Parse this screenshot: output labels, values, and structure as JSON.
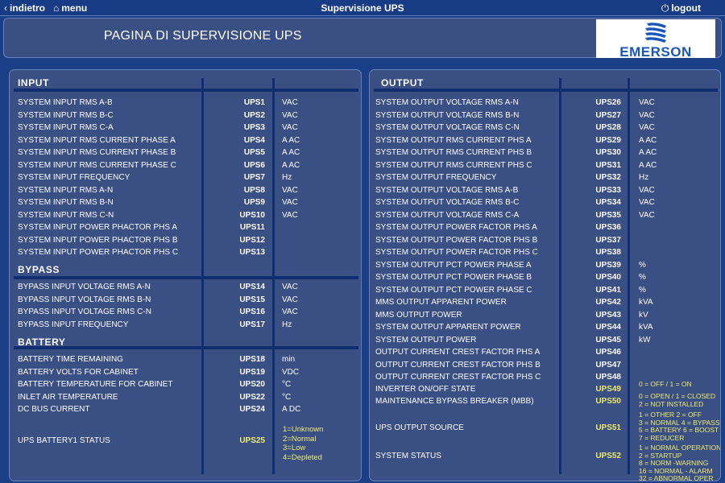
{
  "topbar": {
    "back_label": "indietro",
    "menu_label": "menu",
    "title": "Supervisione UPS",
    "logout_label": "logout"
  },
  "header": {
    "page_title": "PAGINA DI SUPERVISIONE UPS",
    "logo_text": "EMERSON"
  },
  "colors": {
    "background": "#1a3f86",
    "panel": "#3a4f84",
    "divider": "#102d70",
    "highlight": "#ecec6e",
    "logo_blue": "#1a56b8"
  },
  "icons": {
    "back": "chevron-left-icon",
    "menu": "home-icon",
    "logout": "power-icon"
  },
  "left": {
    "input_title": "INPUT",
    "input_rows": [
      {
        "label": "SYSTEM INPUT RMS A-B",
        "code": "UPS1",
        "unit": "VAC"
      },
      {
        "label": "SYSTEM INPUT RMS B-C",
        "code": "UPS2",
        "unit": "VAC"
      },
      {
        "label": "SYSTEM INPUT RMS C-A",
        "code": "UPS3",
        "unit": "VAC"
      },
      {
        "label": "SYSTEM INPUT RMS CURRENT PHASE A",
        "code": "UPS4",
        "unit": "A AC"
      },
      {
        "label": "SYSTEM INPUT RMS CURRENT PHASE B",
        "code": "UPS5",
        "unit": "A AC"
      },
      {
        "label": "SYSTEM INPUT RMS CURRENT PHASE C",
        "code": "UPS6",
        "unit": "A AC"
      },
      {
        "label": "SYSTEM INPUT FREQUENCY",
        "code": "UPS7",
        "unit": "Hz"
      },
      {
        "label": "SYSTEM INPUT RMS A-N",
        "code": "UPS8",
        "unit": "VAC"
      },
      {
        "label": "SYSTEM INPUT RMS B-N",
        "code": "UPS9",
        "unit": "VAC"
      },
      {
        "label": "SYSTEM INPUT RMS C-N",
        "code": "UPS10",
        "unit": "VAC"
      },
      {
        "label": "SYSTEM INPUT POWER PHACTOR PHS A",
        "code": "UPS11",
        "unit": ""
      },
      {
        "label": "SYSTEM INPUT POWER PHACTOR PHS B",
        "code": "UPS12",
        "unit": ""
      },
      {
        "label": "SYSTEM INPUT POWER PHACTOR PHS C",
        "code": "UPS13",
        "unit": ""
      }
    ],
    "bypass_title": "BYPASS",
    "bypass_rows": [
      {
        "label": "BYPASS INPUT VOLTAGE RMS A-N",
        "code": "UPS14",
        "unit": "VAC"
      },
      {
        "label": "BYPASS INPUT VOLTAGE RMS B-N",
        "code": "UPS15",
        "unit": "VAC"
      },
      {
        "label": "BYPASS INPUT VOLTAGE RMS C-N",
        "code": "UPS16",
        "unit": "VAC"
      },
      {
        "label": "BYPASS INPUT FREQUENCY",
        "code": "UPS17",
        "unit": "Hz"
      }
    ],
    "battery_title": "BATTERY",
    "battery_rows": [
      {
        "label": "BATTERY TIME REMAINING",
        "code": "UPS18",
        "unit": "min"
      },
      {
        "label": "BATTERY VOLTS FOR CABINET",
        "code": "UPS19",
        "unit": "VDC"
      },
      {
        "label": "BATTERY TEMPERATURE FOR CABINET",
        "code": "UPS20",
        "unit": "°C"
      },
      {
        "label": "INLET AIR TEMPERATURE",
        "code": "UPS22",
        "unit": "°C"
      },
      {
        "label": "DC BUS CURRENT",
        "code": "UPS24",
        "unit": "A DC"
      }
    ],
    "battery_status": {
      "label": "UPS BATTERY1 STATUS",
      "code": "UPS25",
      "notes": [
        "1=Unknown",
        "2=Normal",
        "3=Low",
        "4=Depleted"
      ]
    }
  },
  "right": {
    "output_title": "OUTPUT",
    "output_rows": [
      {
        "label": "SYSTEM OUTPUT VOLTAGE RMS A-N",
        "code": "UPS26",
        "unit": "VAC"
      },
      {
        "label": "SYSTEM OUTPUT VOLTAGE RMS B-N",
        "code": "UPS27",
        "unit": "VAC"
      },
      {
        "label": "SYSTEM OUTPUT VOLTAGE RMS C-N",
        "code": "UPS28",
        "unit": "VAC"
      },
      {
        "label": "SYSTEM OUTPUT RMS CURRENT PHS A",
        "code": "UPS29",
        "unit": "A AC"
      },
      {
        "label": "SYSTEM OUTPUT RMS CURRENT PHS B",
        "code": "UPS30",
        "unit": "A AC"
      },
      {
        "label": "SYSTEM OUTPUT RMS CURRENT PHS C",
        "code": "UPS31",
        "unit": "A AC"
      },
      {
        "label": "SYSTEM OUTPUT FREQUENCY",
        "code": "UPS32",
        "unit": "Hz"
      },
      {
        "label": "SYSTEM OUTPUT VOLTAGE RMS A-B",
        "code": "UPS33",
        "unit": "VAC"
      },
      {
        "label": "SYSTEM OUTPUT VOLTAGE RMS B-C",
        "code": "UPS34",
        "unit": "VAC"
      },
      {
        "label": "SYSTEM OUTPUT VOLTAGE RMS C-A",
        "code": "UPS35",
        "unit": "VAC"
      },
      {
        "label": "SYSTEM OUTPUT POWER FACTOR PHS A",
        "code": "UPS36",
        "unit": ""
      },
      {
        "label": "SYSTEM OUTPUT POWER FACTOR PHS B",
        "code": "UPS37",
        "unit": ""
      },
      {
        "label": "SYSTEM OUTPUT POWER FACTOR PHS C",
        "code": "UPS38",
        "unit": ""
      },
      {
        "label": "SYSTEM OUTPUT PCT POWER PHASE A",
        "code": "UPS39",
        "unit": "%"
      },
      {
        "label": "SYSTEM OUTPUT PCT POWER PHASE B",
        "code": "UPS40",
        "unit": "%"
      },
      {
        "label": "SYSTEM OUTPUT PCT POWER PHASE C",
        "code": "UPS41",
        "unit": "%"
      },
      {
        "label": "MMS OUTPUT APPARENT POWER",
        "code": "UPS42",
        "unit": "kVA"
      },
      {
        "label": "MMS OUTPUT POWER",
        "code": "UPS43",
        "unit": "kV"
      },
      {
        "label": "SYSTEM OUTPUT APPARENT POWER",
        "code": "UPS44",
        "unit": "kVA"
      },
      {
        "label": "SYSTEM OUTPUT POWER",
        "code": "UPS45",
        "unit": "kW"
      },
      {
        "label": "OUTPUT CURRENT CREST FACTOR PHS A",
        "code": "UPS46",
        "unit": ""
      },
      {
        "label": "OUTPUT CURRENT CREST FACTOR PHS B",
        "code": "UPS47",
        "unit": ""
      },
      {
        "label": "OUTPUT CURRENT CREST FACTOR PHS C",
        "code": "UPS48",
        "unit": ""
      }
    ],
    "status_rows": [
      {
        "label": "INVERTER ON/OFF STATE",
        "code": "UPS49",
        "notes": [
          "0 = OFF / 1 = ON"
        ]
      },
      {
        "label": "MAINTENANCE BYPASS BREAKER (MBB)",
        "code": "UPS50",
        "notes": [
          "0 = OPEN / 1 = CLOSED",
          "2 = NOT INSTALLED"
        ]
      },
      {
        "label": "UPS OUTPUT SOURCE",
        "code": "UPS51",
        "notes": [
          "1 = OTHER 2 = OFF",
          "3 = NORMAL 4 = BYPASS",
          "5 = BATTERY 6 = BOOST",
          "7 = REDUCER"
        ]
      },
      {
        "label": "SYSTEM STATUS",
        "code": "UPS52",
        "notes": [
          "1 = NORMAL OPERATION",
          "2 = STARTUP",
          "8 = NORM -WARNING",
          "16 = NORMAL - ALARM",
          "32 = ABNORMAL OPER"
        ]
      }
    ]
  }
}
